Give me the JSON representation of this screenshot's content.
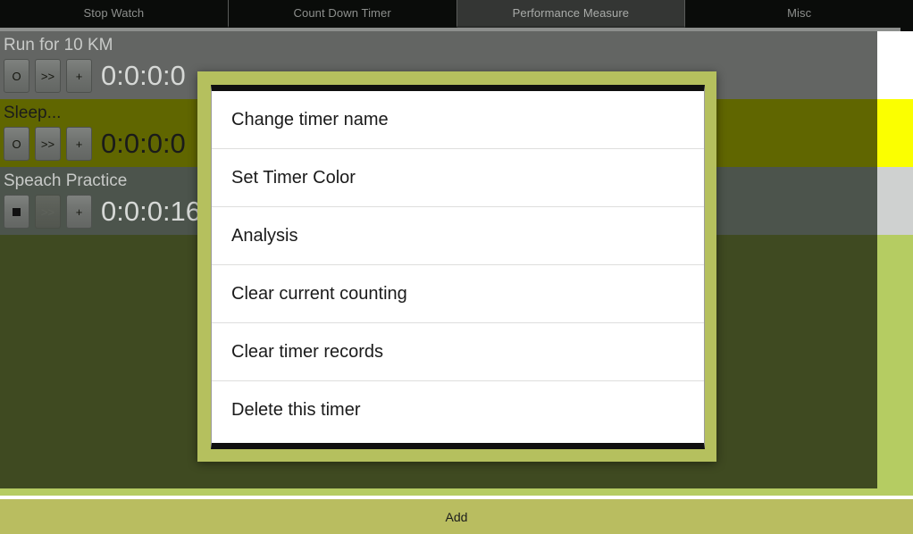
{
  "tabs": [
    {
      "label": "Stop Watch",
      "selected": false
    },
    {
      "label": "Count Down Timer",
      "selected": false
    },
    {
      "label": "Performance Measure",
      "selected": true
    },
    {
      "label": "Misc",
      "selected": false
    }
  ],
  "timers": [
    {
      "name": "Run for 10 KM",
      "value": "0:0:0:0",
      "row_color": "#636563",
      "swatch_color": "#ffffff",
      "name_color": "light",
      "value_color": "light",
      "buttons": [
        {
          "label": "O",
          "name": "record-button",
          "state": "enabled"
        },
        {
          "label": ">>",
          "name": "lap-button",
          "state": "enabled"
        },
        {
          "label": "+",
          "name": "increment-button",
          "state": "enabled"
        }
      ]
    },
    {
      "name": "Sleep...",
      "value": "0:0:0:0",
      "row_color": "#606600",
      "swatch_color": "#fbff00",
      "name_color": "dark",
      "value_color": "dark",
      "buttons": [
        {
          "label": "O",
          "name": "record-button",
          "state": "enabled"
        },
        {
          "label": ">>",
          "name": "lap-button",
          "state": "enabled"
        },
        {
          "label": "+",
          "name": "increment-button",
          "state": "enabled"
        }
      ]
    },
    {
      "name": "Speach Practice",
      "value": "0:0:0:16",
      "row_color": "#4c544c",
      "swatch_color": "#cfd1d0",
      "name_color": "light",
      "value_color": "light",
      "buttons": [
        {
          "label": "",
          "name": "stop-button",
          "state": "stop"
        },
        {
          "label": ">>",
          "name": "lap-button",
          "state": "disabled"
        },
        {
          "label": "+",
          "name": "increment-button",
          "state": "enabled"
        }
      ]
    }
  ],
  "dialog": {
    "items": [
      {
        "label": "Change timer name",
        "name": "menu-item-change-timer-name"
      },
      {
        "label": "Set Timer Color",
        "name": "menu-item-set-timer-color"
      },
      {
        "label": "Analysis",
        "name": "menu-item-analysis"
      },
      {
        "label": "Clear current counting",
        "name": "menu-item-clear-current-counting"
      },
      {
        "label": "Clear timer records",
        "name": "menu-item-clear-timer-records"
      },
      {
        "label": "Delete this timer",
        "name": "menu-item-delete-this-timer"
      }
    ]
  },
  "bottom_bar": {
    "add_label": "Add"
  },
  "colors": {
    "dialog_frame": "#b5c05e",
    "background": "#3f4a21",
    "accent_green": "#b5cc62",
    "add_bar": "#b9bd60"
  }
}
